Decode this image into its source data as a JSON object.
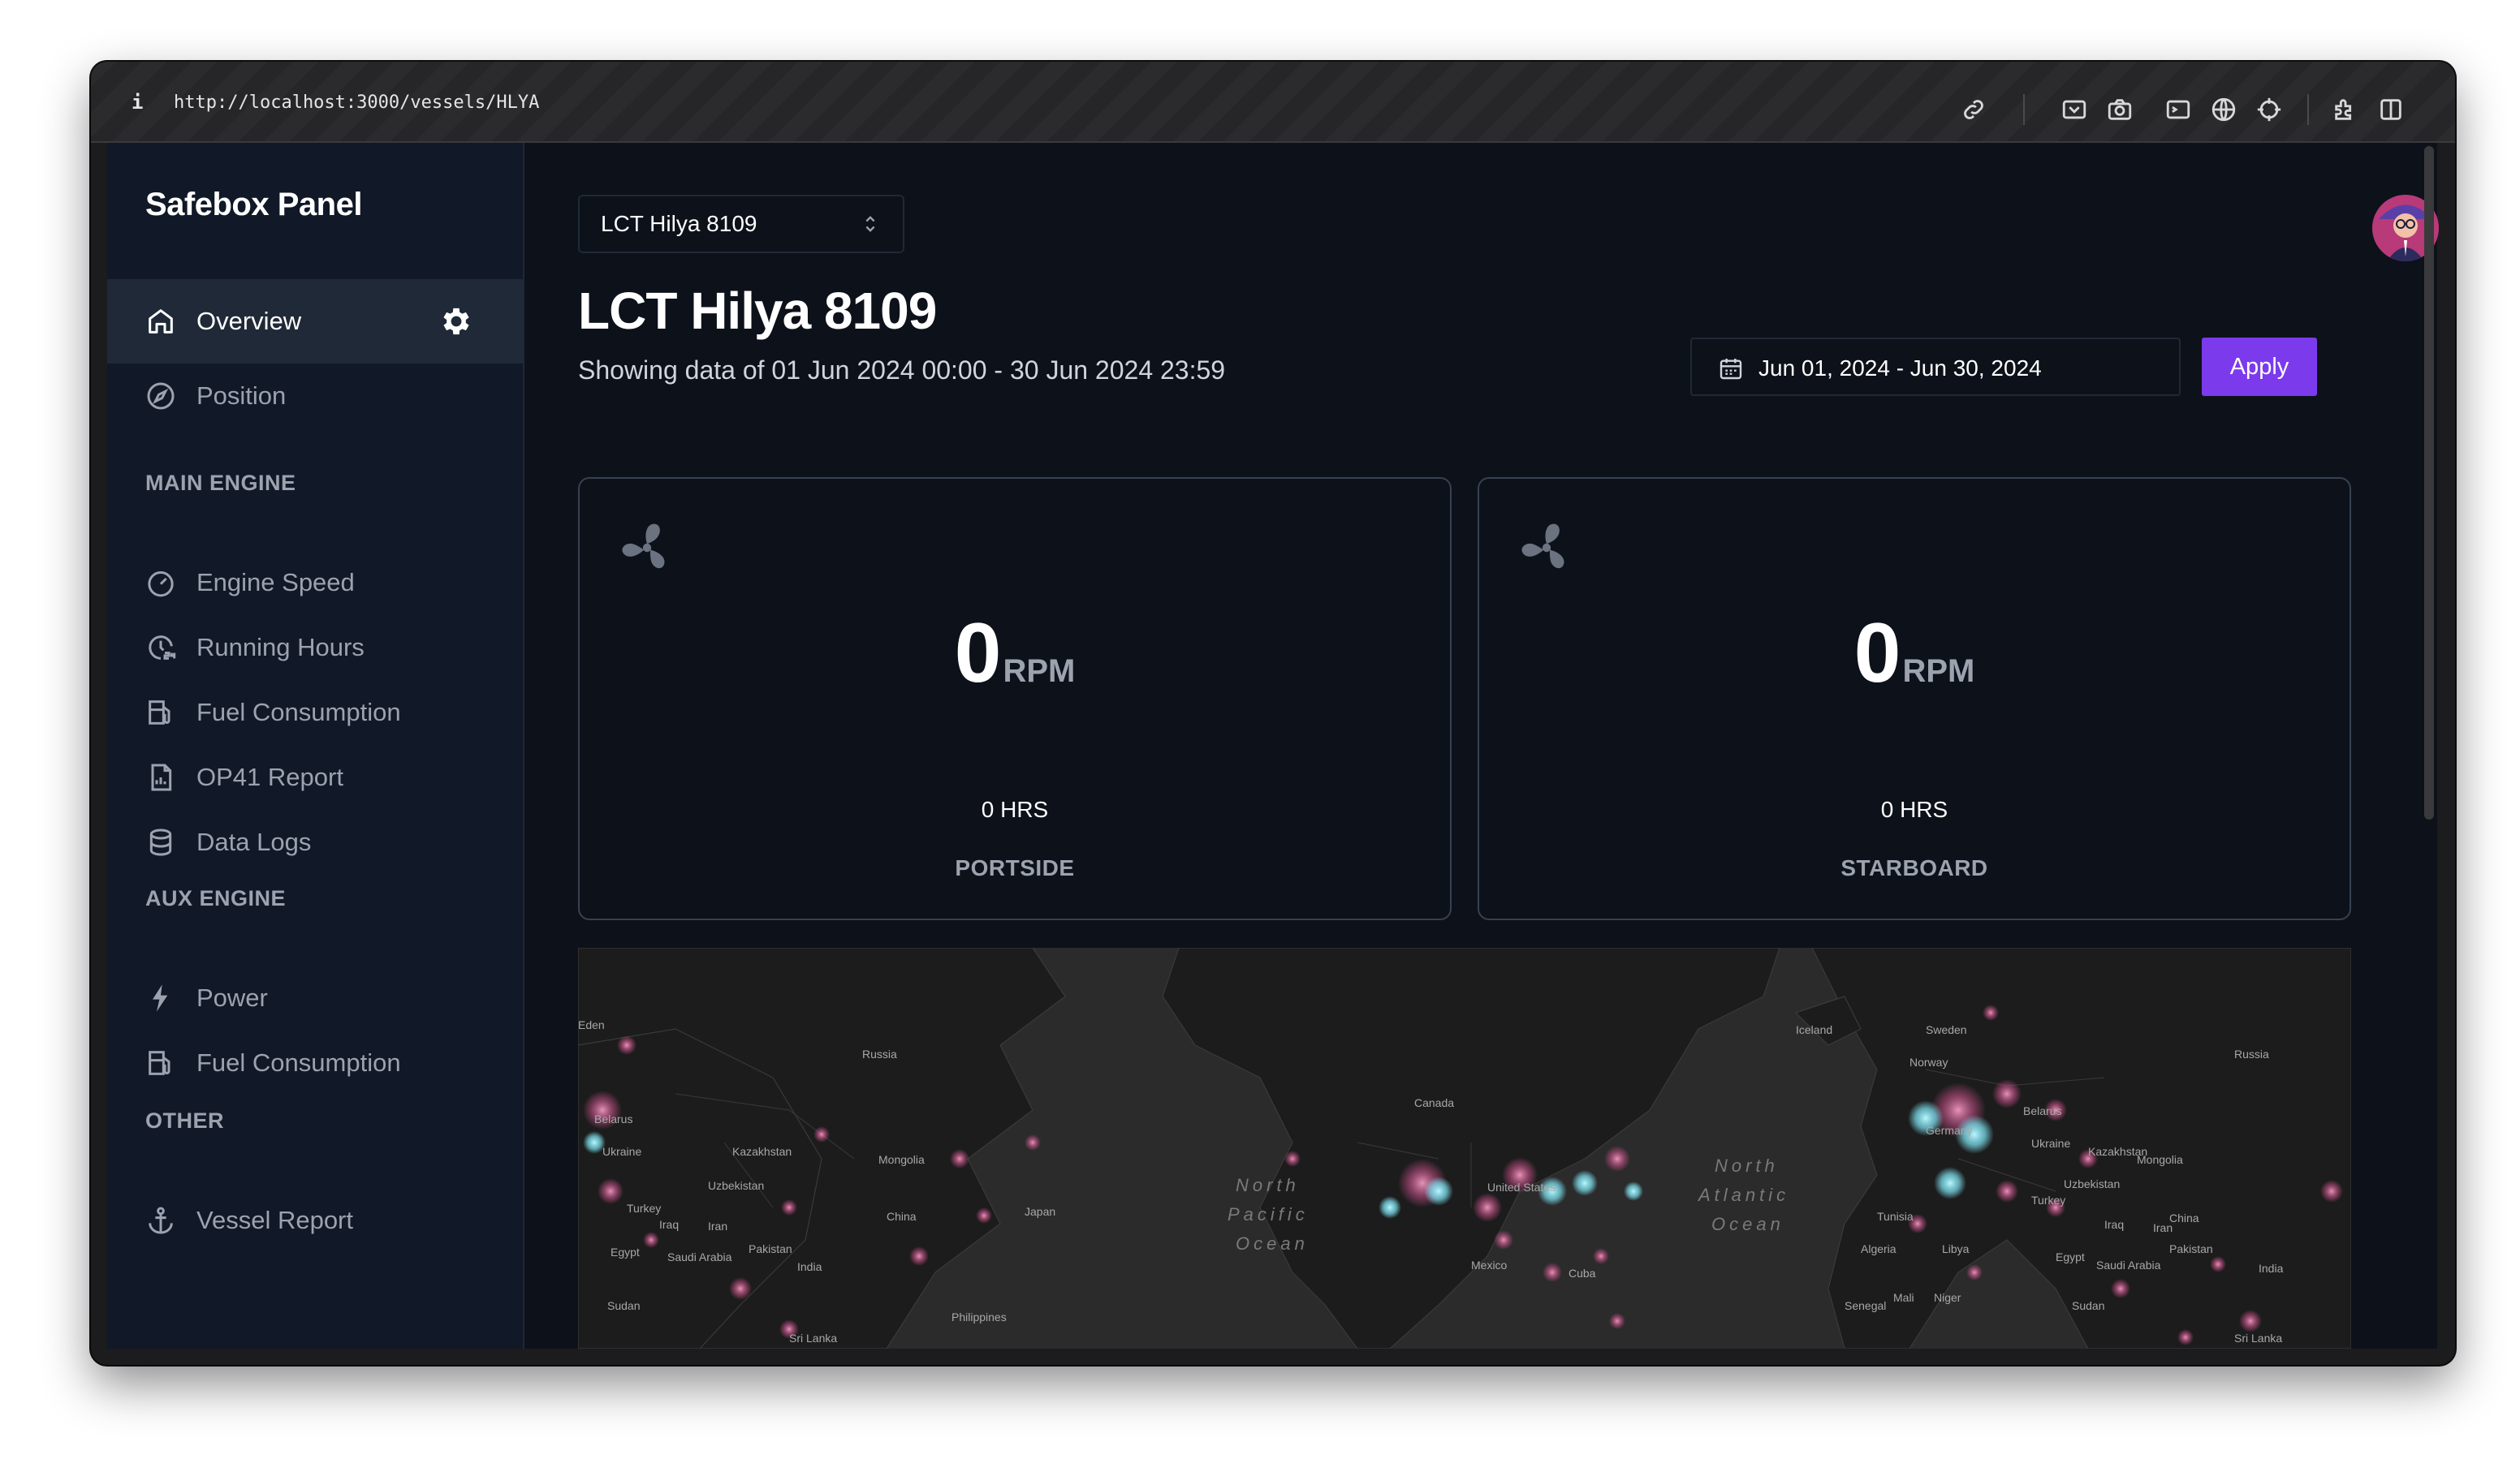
{
  "browser": {
    "info_icon": "i",
    "url": "http://localhost:3000/vessels/HLYA",
    "toolbar_icons": [
      "link-icon",
      "screenshot-icon",
      "camera-icon",
      "terminal-icon",
      "globe-icon",
      "crosshair-icon",
      "extensions-icon",
      "sidebar-icon"
    ]
  },
  "sidebar": {
    "brand": "Safebox Panel",
    "top_items": [
      {
        "label": "Overview",
        "icon": "home-icon",
        "active": true
      },
      {
        "label": "Position",
        "icon": "compass-icon",
        "active": false
      }
    ],
    "sections": [
      {
        "title": "MAIN ENGINE",
        "items": [
          {
            "label": "Engine Speed",
            "icon": "gauge-icon"
          },
          {
            "label": "Running Hours",
            "icon": "clock-24-icon"
          },
          {
            "label": "Fuel Consumption",
            "icon": "fuel-icon"
          },
          {
            "label": "OP41 Report",
            "icon": "report-icon"
          },
          {
            "label": "Data Logs",
            "icon": "database-icon"
          }
        ]
      },
      {
        "title": "AUX ENGINE",
        "items": [
          {
            "label": "Power",
            "icon": "bolt-icon"
          },
          {
            "label": "Fuel Consumption",
            "icon": "fuel-icon"
          }
        ]
      },
      {
        "title": "OTHER",
        "items": [
          {
            "label": "Vessel Report",
            "icon": "anchor-icon"
          }
        ]
      }
    ]
  },
  "header": {
    "vessel_select": "LCT Hilya 8109",
    "title": "LCT Hilya 8109",
    "subtitle": "Showing data of 01 Jun 2024 00:00 - 30 Jun 2024 23:59",
    "date_range": "Jun 01, 2024 - Jun 30, 2024",
    "apply_label": "Apply"
  },
  "engines": [
    {
      "rpm": "0",
      "unit": "RPM",
      "hours": "0 HRS",
      "side": "PORTSIDE"
    },
    {
      "rpm": "0",
      "unit": "RPM",
      "hours": "0 HRS",
      "side": "STARBOARD"
    }
  ],
  "map": {
    "labels": [
      "Russia",
      "Kazakhstan",
      "Mongolia",
      "China",
      "Japan",
      "Iran",
      "Iraq",
      "Turkey",
      "Ukraine",
      "Belarus",
      "Egypt",
      "Saudi Arabia",
      "Pakistan",
      "India",
      "Sri Lanka",
      "Sudan",
      "Philippines",
      "Canada",
      "United States",
      "Mexico",
      "Cuba",
      "Iceland",
      "Sweden",
      "Norway",
      "Germany",
      "Algeria",
      "Libya",
      "Tunisia",
      "Mali",
      "Niger",
      "Senegal",
      "Uzbekistan",
      "Eden"
    ],
    "oceans": [
      "North Pacific Ocean",
      "North Atlantic Ocean"
    ]
  },
  "colors": {
    "accent": "#7c3aed",
    "sidebar_bg": "#111827",
    "main_bg": "#0d111a",
    "heat_pink": "#e879a8",
    "heat_cyan": "#7ee6f5"
  }
}
